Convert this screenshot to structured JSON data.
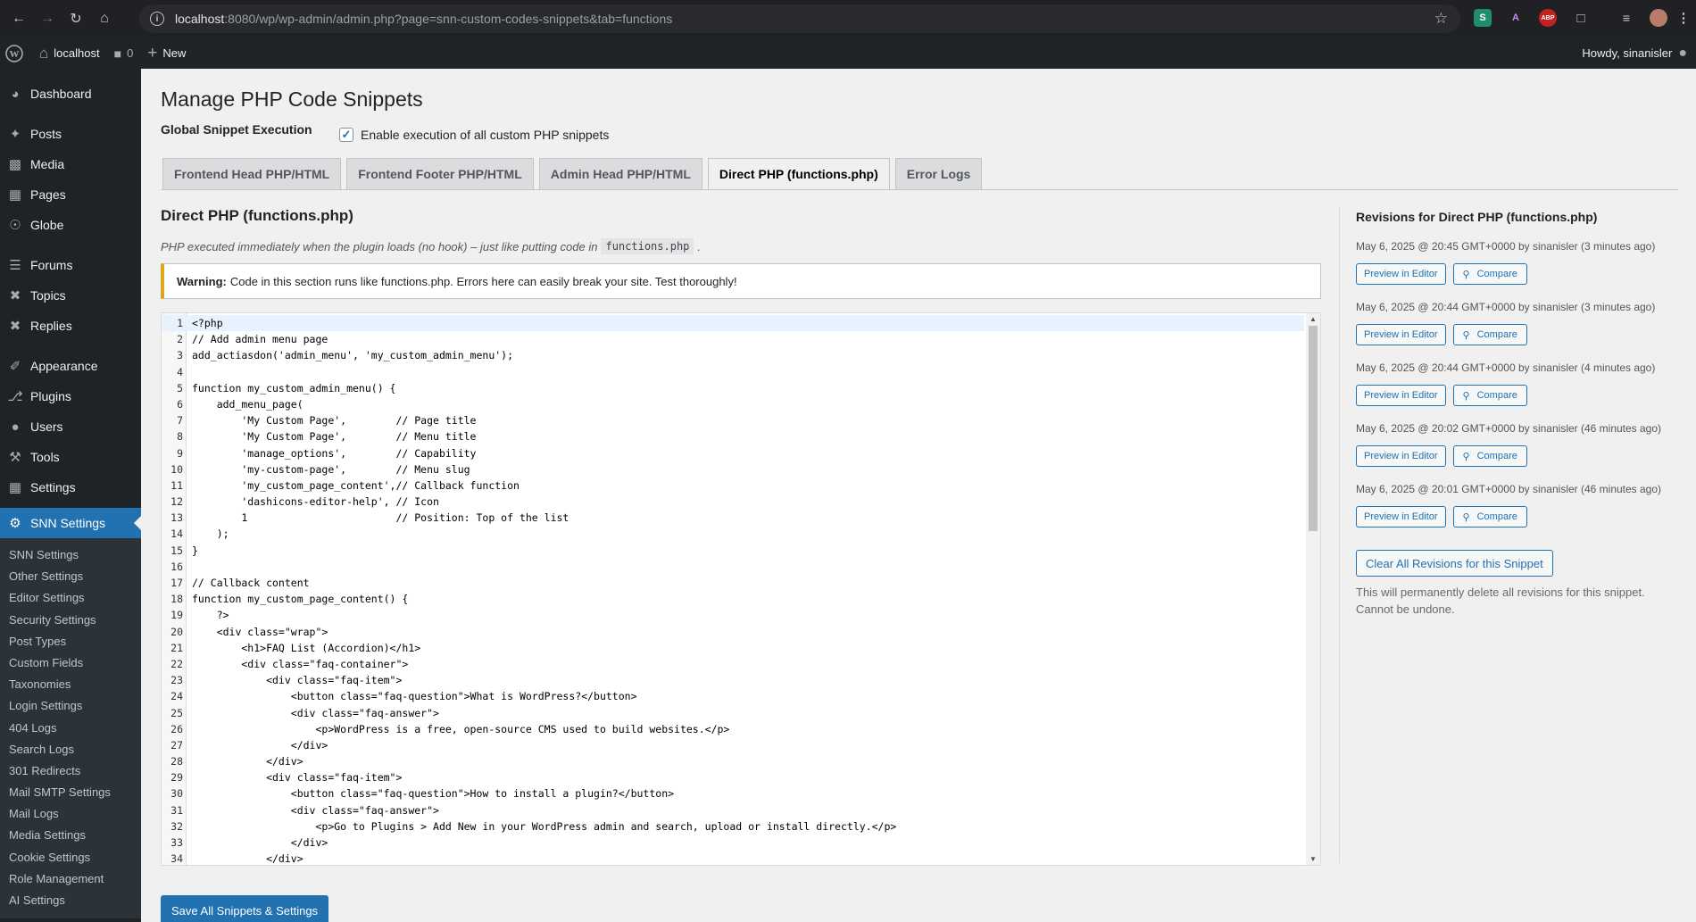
{
  "browser": {
    "url_host": "localhost",
    "url_rest": ":8080/wp/wp-admin/admin.php?page=snn-custom-codes-snippets&tab=functions"
  },
  "adminbar": {
    "site_name": "localhost",
    "comments_count": "0",
    "new_label": "New",
    "howdy": "Howdy, sinanisler"
  },
  "sidebar": {
    "items": [
      {
        "label": "Dashboard",
        "icon": "dashboard-icon"
      },
      {
        "label": "Posts",
        "icon": "pin-icon"
      },
      {
        "label": "Media",
        "icon": "media-icon"
      },
      {
        "label": "Pages",
        "icon": "pages-icon"
      },
      {
        "label": "Globe",
        "icon": "globe-icon"
      },
      {
        "label": "Forums",
        "icon": "forums-icon"
      },
      {
        "label": "Topics",
        "icon": "topics-icon"
      },
      {
        "label": "Replies",
        "icon": "replies-icon"
      },
      {
        "label": "Appearance",
        "icon": "brush-icon"
      },
      {
        "label": "Plugins",
        "icon": "plugin-icon"
      },
      {
        "label": "Users",
        "icon": "user-icon"
      },
      {
        "label": "Tools",
        "icon": "wrench-icon"
      },
      {
        "label": "Settings",
        "icon": "settings-icon"
      },
      {
        "label": "SNN Settings",
        "icon": "gear-icon"
      }
    ],
    "submenu": [
      "SNN Settings",
      "Other Settings",
      "Editor Settings",
      "Security Settings",
      "Post Types",
      "Custom Fields",
      "Taxonomies",
      "Login Settings",
      "404 Logs",
      "Search Logs",
      "301 Redirects",
      "Mail SMTP Settings",
      "Mail Logs",
      "Media Settings",
      "Cookie Settings",
      "Role Management",
      "AI Settings"
    ]
  },
  "page": {
    "title": "Manage PHP Code Snippets",
    "global_label": "Global Snippet Execution",
    "global_checkbox": "Enable execution of all custom PHP snippets",
    "tabs": [
      "Frontend Head PHP/HTML",
      "Frontend Footer PHP/HTML",
      "Admin Head PHP/HTML",
      "Direct PHP (functions.php)",
      "Error Logs"
    ],
    "active_tab": 3,
    "section_title": "Direct PHP (functions.php)",
    "section_desc": "PHP executed immediately when the plugin loads (no hook) – just like putting code in",
    "section_desc_code": "functions.php",
    "section_desc_end": ".",
    "warning_bold": "Warning:",
    "warning_text": "Code in this section runs like functions.php. Errors here can easily break your site. Test thoroughly!",
    "save_button": "Save All Snippets & Settings"
  },
  "code": [
    "<?php",
    "// Add admin menu page",
    "add_actiasdon('admin_menu', 'my_custom_admin_menu');",
    "",
    "function my_custom_admin_menu() {",
    "    add_menu_page(",
    "        'My Custom Page',        // Page title",
    "        'My Custom Page',        // Menu title",
    "        'manage_options',        // Capability",
    "        'my-custom-page',        // Menu slug",
    "        'my_custom_page_content',// Callback function",
    "        'dashicons-editor-help', // Icon",
    "        1                        // Position: Top of the list",
    "    );",
    "}",
    "",
    "// Callback content",
    "function my_custom_page_content() {",
    "    ?>",
    "    <div class=\"wrap\">",
    "        <h1>FAQ List (Accordion)</h1>",
    "        <div class=\"faq-container\">",
    "            <div class=\"faq-item\">",
    "                <button class=\"faq-question\">What is WordPress?</button>",
    "                <div class=\"faq-answer\">",
    "                    <p>WordPress is a free, open-source CMS used to build websites.</p>",
    "                </div>",
    "            </div>",
    "            <div class=\"faq-item\">",
    "                <button class=\"faq-question\">How to install a plugin?</button>",
    "                <div class=\"faq-answer\">",
    "                    <p>Go to Plugins > Add New in your WordPress admin and search, upload or install directly.</p>",
    "                </div>",
    "            </div>"
  ],
  "revisions": {
    "title": "Revisions for Direct PHP (functions.php)",
    "preview_label": "Preview in Editor",
    "compare_label": "Compare",
    "entries": [
      "May 6, 2025 @ 20:45 GMT+0000 by sinanisler (3 minutes ago)",
      "May 6, 2025 @ 20:44 GMT+0000 by sinanisler (3 minutes ago)",
      "May 6, 2025 @ 20:44 GMT+0000 by sinanisler (4 minutes ago)",
      "May 6, 2025 @ 20:02 GMT+0000 by sinanisler (46 minutes ago)",
      "May 6, 2025 @ 20:01 GMT+0000 by sinanisler (46 minutes ago)"
    ],
    "clear_button": "Clear All Revisions for this Snippet",
    "clear_desc": "This will permanently delete all revisions for this snippet. Cannot be undone."
  },
  "colors": {
    "admin_dark": "#1d2327",
    "accent": "#2271b1",
    "warning": "#dba617"
  }
}
